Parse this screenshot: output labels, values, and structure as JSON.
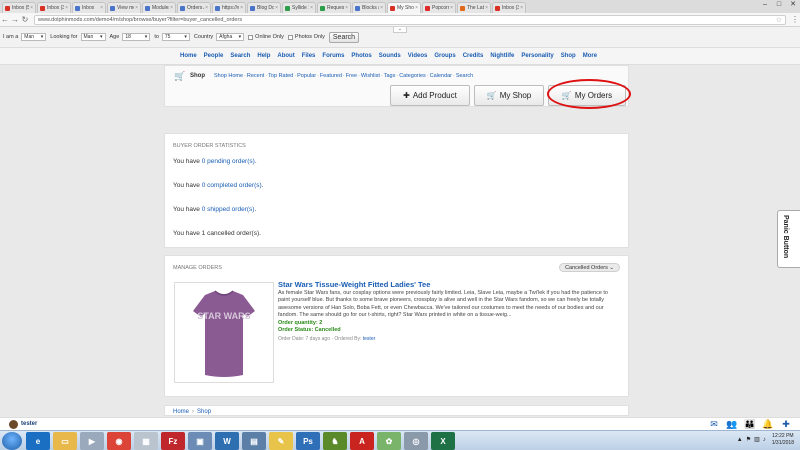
{
  "browser": {
    "tabs": [
      {
        "label": "Inbox (57)",
        "color": "#d93025"
      },
      {
        "label": "Inbox (36)",
        "color": "#d93025"
      },
      {
        "label": "Inbox",
        "color": "#4a74c9"
      },
      {
        "label": "View mess",
        "color": "#4a74c9"
      },
      {
        "label": "Modules",
        "color": "#4a74c9"
      },
      {
        "label": "Orders Ad",
        "color": "#4a74c9"
      },
      {
        "label": "https://w",
        "color": "#4a74c9"
      },
      {
        "label": "Blog Dolla",
        "color": "#4a74c9"
      },
      {
        "label": "Syllide 10",
        "color": "#2e9d4a"
      },
      {
        "label": "Request :",
        "color": "#2e9d4a"
      },
      {
        "label": "Blocks at",
        "color": "#4a74c9"
      },
      {
        "label": "My Shop",
        "color": "#d93025",
        "active": true
      },
      {
        "label": "Popcorn",
        "color": "#e02a2a"
      },
      {
        "label": "The Lates",
        "color": "#e06a1a"
      },
      {
        "label": "Inbox (35)",
        "color": "#d93025"
      }
    ],
    "url": "www.dolphinmods.com/demo4/m/shop/browse/buyer?filter=buyer_cancelled_orders"
  },
  "filters": {
    "i_am_label": "I am a",
    "i_am_value": "Man",
    "looking_for_label": "Looking for",
    "looking_for_value": "Man",
    "age_label": "Age",
    "age_from": "18",
    "to_label": "to",
    "age_to": "75",
    "country_label": "Country",
    "country_value": "Afgha",
    "online_only_label": "Online Only",
    "photos_only_label": "Photos Only",
    "search_button": "Search"
  },
  "site_nav": [
    "Home",
    "People",
    "Search",
    "Help",
    "About",
    "Files",
    "Forums",
    "Photos",
    "Sounds",
    "Videos",
    "Groups",
    "Credits",
    "Nightlife",
    "Personality",
    "Shop",
    "More"
  ],
  "shop": {
    "title": "Shop",
    "links": [
      "Shop Home",
      "Recent",
      "Top Rated",
      "Popular",
      "Featured",
      "Free",
      "Wishlist",
      "Tags",
      "Categories",
      "Calendar",
      "Search"
    ],
    "add_product": "Add Product",
    "my_shop": "My Shop",
    "my_orders": "My Orders"
  },
  "stats": {
    "title": "BUYER ORDER STATISTICS",
    "lines": [
      {
        "prefix": "You have ",
        "count": "0 pending order(s)",
        "suffix": "."
      },
      {
        "prefix": "You have ",
        "count": "0 completed order(s)",
        "suffix": "."
      },
      {
        "prefix": "You have ",
        "count": "0 shipped order(s)",
        "suffix": "."
      },
      {
        "prefix": "You have 1 cancelled order(s).",
        "count": "",
        "suffix": ""
      }
    ]
  },
  "orders": {
    "title": "MANAGE ORDERS",
    "filter": "Cancelled Orders",
    "item": {
      "title": "Star Wars Tissue-Weight Fitted Ladies' Tee",
      "description": "As female Star Wars fans, our cosplay options were previously fairly limited. Leia, Slave Leia, maybe a Twi'lek if you had the patience to paint yourself blue. But thanks to some brave pioneers, crossplay is alive and well in the Star Wars fandom, so we can freely be totally awesome versions of Han Solo, Boba Fett, or even Chewbacca. We've tailored our costumes to meet the needs of our bodies and our fandom. The same should go for our t-shirts, right? Star Wars printed in white on a tissue-weig...",
      "quantity": "Order quantity: 2",
      "status": "Order Status: Cancelled",
      "date": "Order Date: 7 days ago · Ordered By: ",
      "ordered_by": "tester",
      "shirt_text": "STAR WARS"
    }
  },
  "breadcrumb": [
    "Home",
    "Shop"
  ],
  "panic_button": "Panic Button",
  "user": {
    "name": "tester"
  },
  "taskbar": {
    "time": "12:22 PM",
    "date": "1/31/2018"
  }
}
